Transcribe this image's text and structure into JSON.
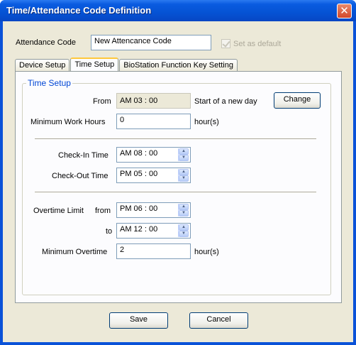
{
  "window": {
    "title": "Time/Attendance Code Definition",
    "close_symbol": "✕"
  },
  "header": {
    "code_label": "Attendance Code",
    "code_value": "New Attencance Code",
    "default_checkbox_label": "Set as default",
    "default_checked": true,
    "default_enabled": false
  },
  "tabs": [
    {
      "label": "Device Setup",
      "active": false
    },
    {
      "label": "Time Setup",
      "active": true
    },
    {
      "label": "BioStation Function Key Setting",
      "active": false
    }
  ],
  "time_setup": {
    "group_title": "Time Setup",
    "from_label": "From",
    "from_value": "AM  03 : 00",
    "start_day_text": "Start of a new day",
    "change_button": "Change",
    "min_work_label": "Minimum Work Hours",
    "min_work_value": "0",
    "min_work_unit": "hour(s)",
    "checkin_label": "Check-In Time",
    "checkin_value": "AM  08 : 00",
    "checkout_label": "Check-Out Time",
    "checkout_value": "PM  05 : 00",
    "overtime_label": "Overtime Limit",
    "overtime_from_label": "from",
    "overtime_from_value": "PM  06 : 00",
    "overtime_to_label": "to",
    "overtime_to_value": "AM  12 : 00",
    "min_overtime_label": "Minimum Overtime",
    "min_overtime_value": "2",
    "min_overtime_unit": "hour(s)",
    "spin_up": "▲",
    "spin_down": "▼"
  },
  "footer": {
    "save_button": "Save",
    "cancel_button": "Cancel"
  }
}
